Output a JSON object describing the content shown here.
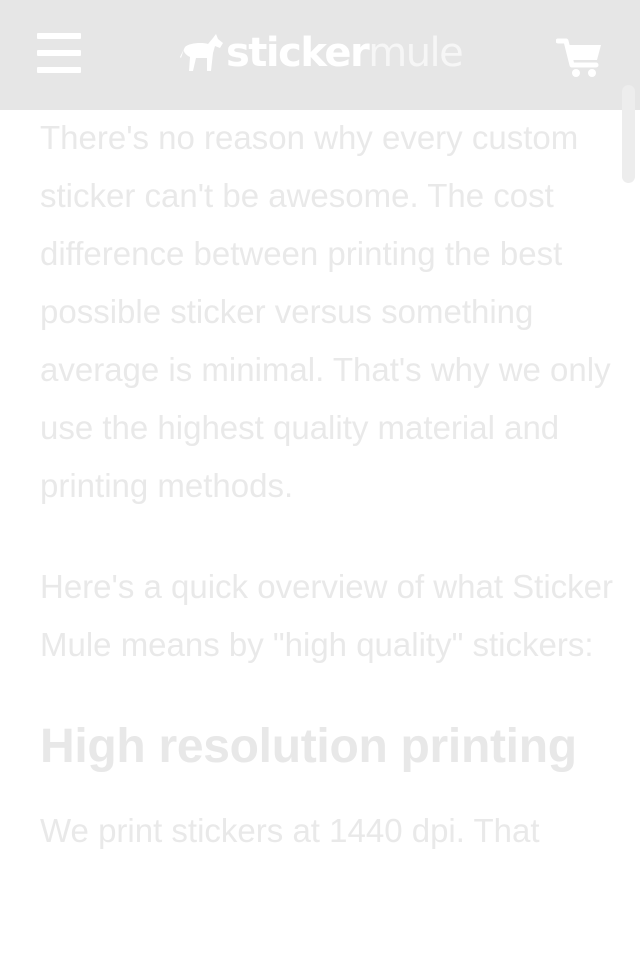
{
  "header": {
    "logo": {
      "word1": "sticker",
      "word2": "mule"
    },
    "menu_icon": "hamburger-menu-icon",
    "cart_icon": "shopping-cart-icon"
  },
  "article": {
    "paragraphs": [
      "There's no reason why every custom sticker can't be awesome. The cost difference between printing the best possible sticker versus something average is minimal. That's why we only use the highest quality material and printing methods.",
      "Here's a quick overview of what Sticker Mule means by \"high quality\" stickers:"
    ],
    "section_heading": "High resolution printing",
    "section_text": "We print stickers at 1440 dpi. That"
  },
  "colors": {
    "header_bg": "#e6e6e6",
    "header_icons": "#ffffff",
    "body_text": "#e9e9e9",
    "page_bg": "#ffffff"
  }
}
